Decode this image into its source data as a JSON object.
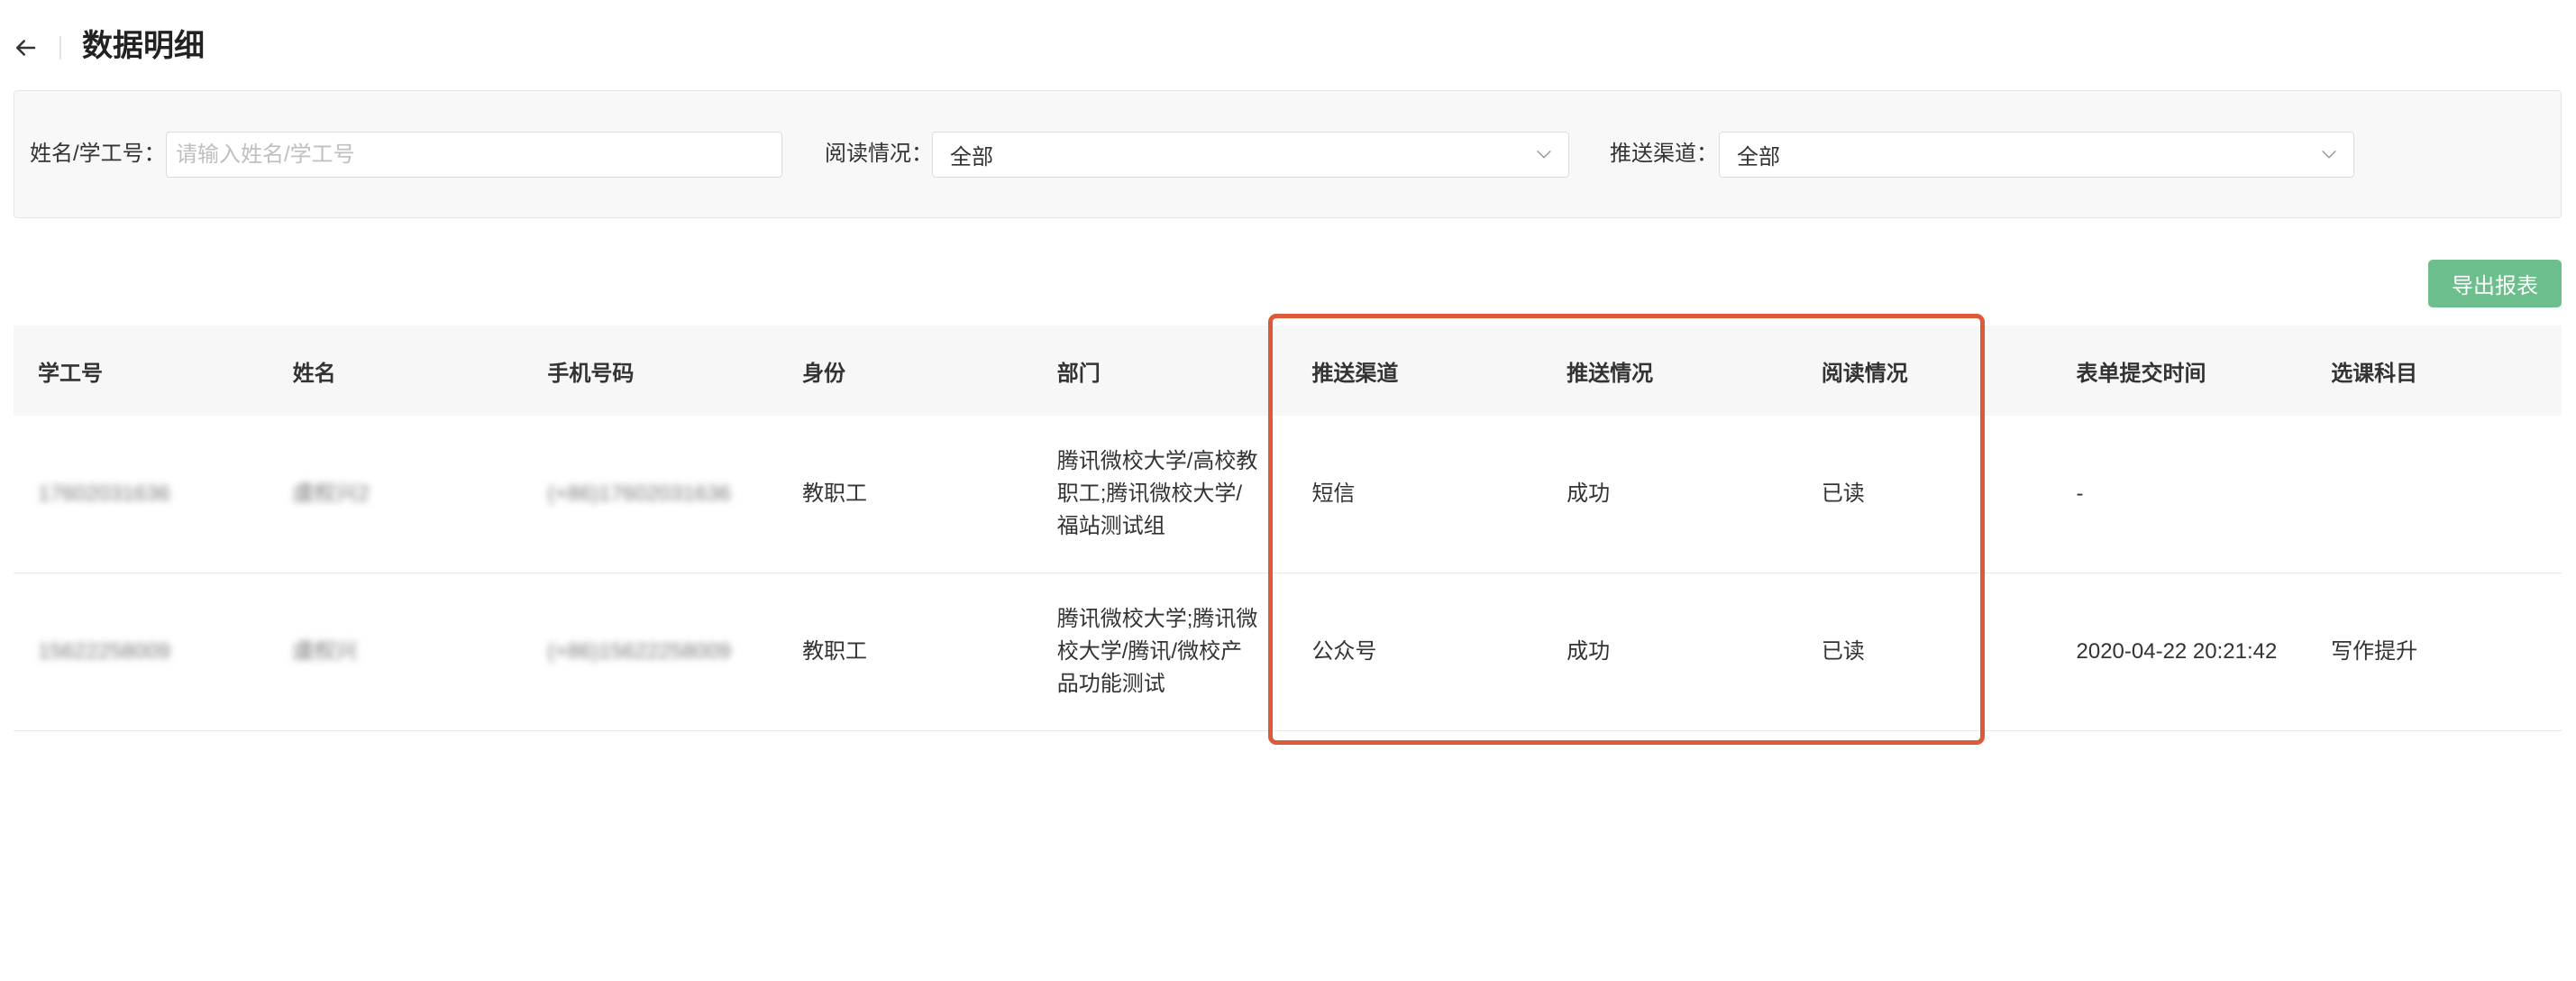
{
  "header": {
    "title": "数据明细",
    "back_icon": "arrow-left-icon"
  },
  "filters": {
    "name_or_id": {
      "label": "姓名/学工号：",
      "value": "",
      "placeholder": "请输入姓名/学工号"
    },
    "read_status": {
      "label": "阅读情况：",
      "selected": "全部",
      "icon": "chevron-down-icon"
    },
    "push_channel": {
      "label": "推送渠道：",
      "selected": "全部",
      "icon": "chevron-down-icon"
    }
  },
  "toolbar": {
    "export_label": "导出报表"
  },
  "table": {
    "columns": [
      "学工号",
      "姓名",
      "手机号码",
      "身份",
      "部门",
      "推送渠道",
      "推送情况",
      "阅读情况",
      "表单提交时间",
      "选课科目"
    ],
    "rows": [
      {
        "student_id": "17602031636",
        "name": "虞权兴2",
        "phone": "(+86)17602031636",
        "role": "教职工",
        "department": "腾讯微校大学/高校教职工;腾讯微校大学/福站测试组",
        "push_channel": "短信",
        "push_status": "成功",
        "read_status": "已读",
        "submit_time": "-",
        "course": ""
      },
      {
        "student_id": "15622258009",
        "name": "虞权兴",
        "phone": "(+86)15622258009",
        "role": "教职工",
        "department": "腾讯微校大学;腾讯微校大学/腾讯/微校产品功能测试",
        "push_channel": "公众号",
        "push_status": "成功",
        "read_status": "已读",
        "submit_time": "2020-04-22 20:21:42",
        "course": "写作提升"
      }
    ]
  },
  "colors": {
    "accent": "#6cbf8c",
    "highlight": "#dc5b36",
    "panel_background": "#f8f8f8",
    "table_header_background": "#f7f7f7"
  }
}
